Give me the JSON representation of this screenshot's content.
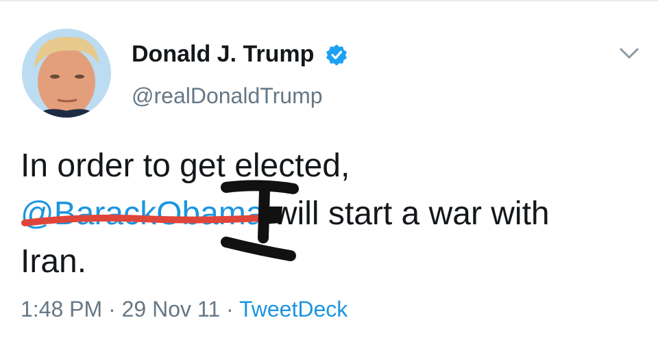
{
  "tweet": {
    "author": {
      "display_name": "Donald J. Trump",
      "handle": "@realDonaldTrump",
      "verified": true
    },
    "text": {
      "line1": "In order to get elected,",
      "mention": "@BarackObama",
      "line2_rest": "will start a war with",
      "line3": "Iran."
    },
    "meta": {
      "time": "1:48 PM",
      "separator": "·",
      "date": "29 Nov 11",
      "source": "TweetDeck"
    }
  },
  "icons": {
    "verified": "verified-badge-icon",
    "menu": "chevron-down-icon"
  },
  "colors": {
    "link": "#1b95e0",
    "secondary_text": "#657786",
    "primary_text": "#14171a",
    "verified_badge": "#1da1f2",
    "strike_red": "#e0453a",
    "marker_black": "#111111"
  }
}
